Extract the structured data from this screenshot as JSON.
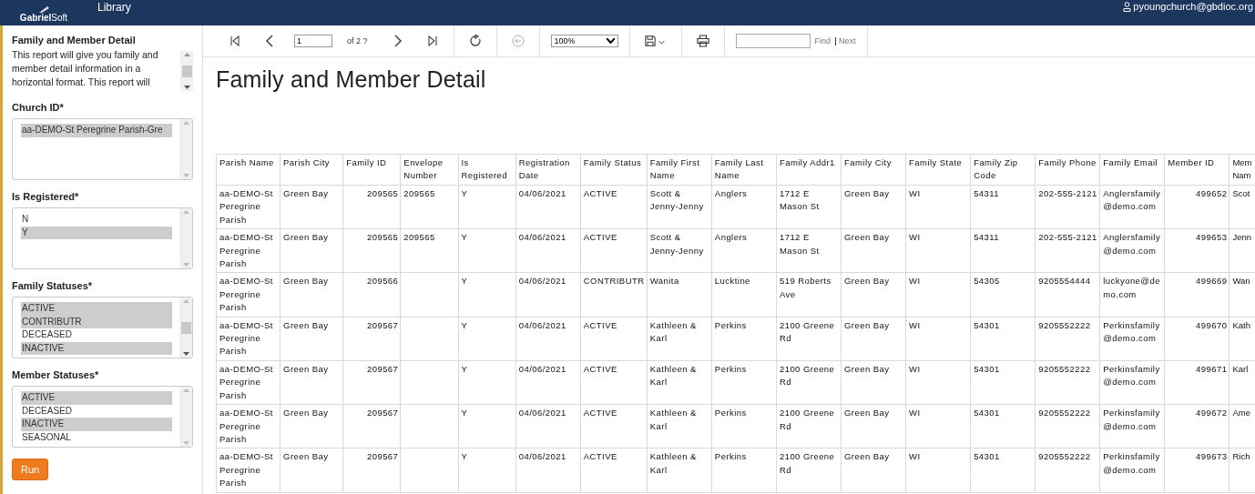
{
  "header": {
    "logo_bold": "Gabriel",
    "logo_light": "Soft",
    "nav_link": "Library",
    "user_email": "pyoungchurch@gbdioc.org"
  },
  "sidebar": {
    "title": "Family and Member Detail",
    "description": "This report will give you family and member detail information in a horizontal format. This report will",
    "parameters": [
      {
        "label": "Church ID*",
        "options": [
          {
            "label": "aa-DEMO-St Peregrine Parish-Gre",
            "selected": true
          }
        ]
      },
      {
        "label": "Is Registered*",
        "options": [
          {
            "label": "N",
            "selected": false
          },
          {
            "label": "Y",
            "selected": true
          }
        ]
      },
      {
        "label": "Family Statuses*",
        "options": [
          {
            "label": "ACTIVE",
            "selected": true
          },
          {
            "label": "CONTRIBUTR",
            "selected": true
          },
          {
            "label": "DECEASED",
            "selected": false
          },
          {
            "label": "INACTIVE",
            "selected": true
          }
        ]
      },
      {
        "label": "Member Statuses*",
        "options": [
          {
            "label": "ACTIVE",
            "selected": true
          },
          {
            "label": "DECEASED",
            "selected": false
          },
          {
            "label": "INACTIVE",
            "selected": true
          },
          {
            "label": "SEASONAL",
            "selected": false
          }
        ]
      }
    ],
    "run_button": "Run"
  },
  "toolbar": {
    "buttons": [
      {
        "kind": "first",
        "disabled": false
      },
      {
        "kind": "prev",
        "disabled": false
      },
      {
        "kind": "next",
        "disabled": false
      },
      {
        "kind": "last",
        "disabled": false
      },
      {
        "kind": "refresh",
        "disabled": false
      },
      {
        "kind": "back",
        "disabled": true
      }
    ],
    "page_value": "1",
    "page_count": "of 2 ?",
    "zoom": "100%",
    "find_link": "Find",
    "next_link": "Next"
  },
  "report": {
    "title": "Family and Member Detail",
    "table": {
      "columns": [
        "Parish Name",
        "Parish City",
        "Family ID",
        "Envelope Number",
        "Is Registered",
        "Registration Date",
        "Family Status",
        "Family First Name",
        "Family Last Name",
        "Family Addr1",
        "Family City",
        "Family State",
        "Family Zip Code",
        "Family Phone",
        "Family Email",
        "Member ID",
        "Mem Nam"
      ],
      "rows": [
        {
          "cells": [
            "aa-DEMO-St Peregrine Parish",
            "Green Bay",
            "209565",
            "209565",
            "Y",
            "04/06/2021",
            "ACTIVE",
            "Scott & Jenny-Jenny",
            "Anglers",
            "1712 E Mason St",
            "Green Bay",
            "WI",
            "54311",
            "202-555-2121",
            "Anglersfamily @demo.com",
            "499652",
            "Scot"
          ]
        },
        {
          "cells": [
            "aa-DEMO-St Peregrine Parish",
            "Green Bay",
            "209565",
            "209565",
            "Y",
            "04/06/2021",
            "ACTIVE",
            "Scott & Jenny-Jenny",
            "Anglers",
            "1712 E Mason St",
            "Green Bay",
            "WI",
            "54311",
            "202-555-2121",
            "Anglersfamily @demo.com",
            "499653",
            "Jenn"
          ]
        },
        {
          "cells": [
            "aa-DEMO-St Peregrine Parish",
            "Green Bay",
            "209566",
            "",
            "Y",
            "04/06/2021",
            "CONTRIBUTR",
            "Wanita",
            "Lucktine",
            "519 Roberts Ave",
            "Green Bay",
            "WI",
            "54305",
            "9205554444",
            "luckyone@de mo.com",
            "499669",
            "Wan"
          ]
        },
        {
          "cells": [
            "aa-DEMO-St Peregrine Parish",
            "Green Bay",
            "209567",
            "",
            "Y",
            "04/06/2021",
            "ACTIVE",
            "Kathleen & Karl",
            "Perkins",
            "2100 Greene Rd",
            "Green Bay",
            "WI",
            "54301",
            "9205552222",
            "Perkinsfamily @demo.com",
            "499670",
            "Kath"
          ]
        },
        {
          "cells": [
            "aa-DEMO-St Peregrine Parish",
            "Green Bay",
            "209567",
            "",
            "Y",
            "04/06/2021",
            "ACTIVE",
            "Kathleen & Karl",
            "Perkins",
            "2100 Greene Rd",
            "Green Bay",
            "WI",
            "54301",
            "9205552222",
            "Perkinsfamily @demo.com",
            "499671",
            "Karl"
          ]
        },
        {
          "cells": [
            "aa-DEMO-St Peregrine Parish",
            "Green Bay",
            "209567",
            "",
            "Y",
            "04/06/2021",
            "ACTIVE",
            "Kathleen & Karl",
            "Perkins",
            "2100 Greene Rd",
            "Green Bay",
            "WI",
            "54301",
            "9205552222",
            "Perkinsfamily @demo.com",
            "499672",
            "Ame"
          ]
        },
        {
          "cells": [
            "aa-DEMO-St Peregrine Parish",
            "Green Bay",
            "209567",
            "",
            "Y",
            "04/06/2021",
            "ACTIVE",
            "Kathleen & Karl",
            "Perkins",
            "2100 Greene Rd",
            "Green Bay",
            "WI",
            "54301",
            "9205552222",
            "Perkinsfamily @demo.com",
            "499673",
            "Rich"
          ]
        }
      ]
    }
  }
}
